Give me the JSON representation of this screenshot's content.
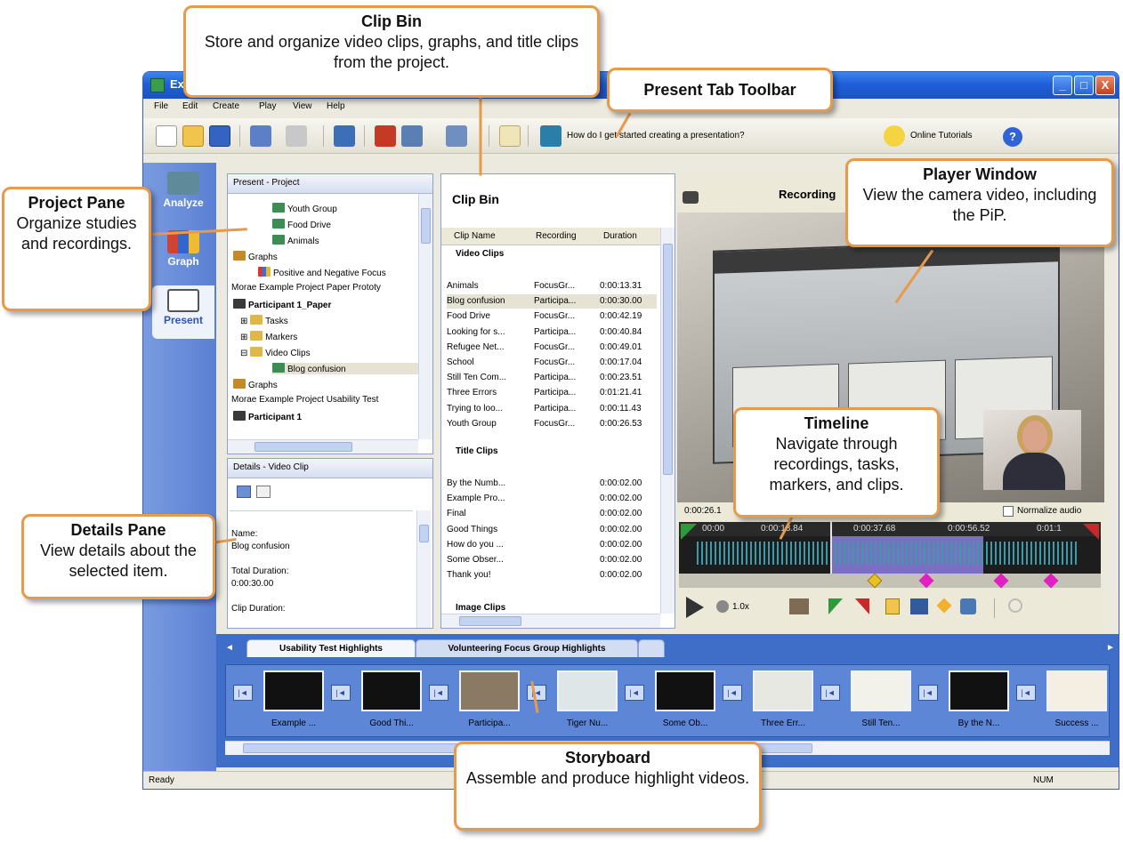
{
  "window": {
    "title": "Ex",
    "buttons": [
      "_",
      "□",
      "X"
    ]
  },
  "menu": [
    "File",
    "Edit",
    "Create",
    "Play",
    "View",
    "Help"
  ],
  "toolbar": {
    "help_text": "How do I get started creating a presentation?",
    "tutorials": "Online Tutorials",
    "help_icon": "?"
  },
  "modes": [
    {
      "label": "Analyze",
      "icon": "monitor-icon"
    },
    {
      "label": "Graph",
      "icon": "bar-graph-icon"
    },
    {
      "label": "Present",
      "icon": "presentation-icon"
    }
  ],
  "project_pane": {
    "header": "Present - Project",
    "items": [
      {
        "label": "Youth Group",
        "icon": "film-icon"
      },
      {
        "label": "Food Drive",
        "icon": "film-icon"
      },
      {
        "label": "Animals",
        "icon": "film-icon"
      },
      {
        "label": "Graphs",
        "icon": "graph-icon"
      },
      {
        "label": "Positive and Negative Focus",
        "icon": "bar-graph-icon"
      },
      {
        "label": "Morae Example Project Paper Prototy",
        "icon": ""
      },
      {
        "label": "Participant 1_Paper",
        "icon": "project-icon"
      },
      {
        "label": "Tasks",
        "icon": "folder-icon"
      },
      {
        "label": "Markers",
        "icon": "folder-icon"
      },
      {
        "label": "Video Clips",
        "icon": "folder-icon"
      },
      {
        "label": "Blog confusion",
        "icon": "film-icon"
      },
      {
        "label": "Graphs",
        "icon": "graph-icon"
      },
      {
        "label": "Morae Example Project Usability Test",
        "icon": ""
      },
      {
        "label": "Participant 1",
        "icon": "project-icon"
      }
    ]
  },
  "details_pane": {
    "header": "Details - Video Clip",
    "lines": [
      "Name:",
      "Blog confusion",
      "",
      "Total Duration:",
      "0:00:30.00",
      "",
      "Clip Duration:"
    ]
  },
  "clip_bin": {
    "title": "Clip Bin",
    "columns": [
      "Clip Name",
      "Recording",
      "Duration"
    ],
    "sections": [
      {
        "name": "Video Clips",
        "rows": [
          [
            "Animals",
            "FocusGr...",
            "0:00:13.31"
          ],
          [
            "Blog confusion",
            "Participa...",
            "0:00:30.00"
          ],
          [
            "Food Drive",
            "FocusGr...",
            "0:00:42.19"
          ],
          [
            "Looking for s...",
            "Participa...",
            "0:00:40.84"
          ],
          [
            "Refugee Net...",
            "FocusGr...",
            "0:00:49.01"
          ],
          [
            "School",
            "FocusGr...",
            "0:00:17.04"
          ],
          [
            "Still Ten Com...",
            "Participa...",
            "0:00:23.51"
          ],
          [
            "Three Errors",
            "Participa...",
            "0:01:21.41"
          ],
          [
            "Trying to loo...",
            "Participa...",
            "0:00:11.43"
          ],
          [
            "Youth Group",
            "FocusGr...",
            "0:00:26.53"
          ]
        ]
      },
      {
        "name": "Title Clips",
        "rows": [
          [
            "By the Numb...",
            "",
            "0:00:02.00"
          ],
          [
            "Example Pro...",
            "",
            "0:00:02.00"
          ],
          [
            "Final",
            "",
            "0:00:02.00"
          ],
          [
            "Good Things",
            "",
            "0:00:02.00"
          ],
          [
            "How do you ...",
            "",
            "0:00:02.00"
          ],
          [
            "Some Obser...",
            "",
            "0:00:02.00"
          ],
          [
            "Thank you!",
            "",
            "0:00:02.00"
          ]
        ]
      },
      {
        "name": "Image Clips",
        "rows": []
      }
    ]
  },
  "player": {
    "title": "Recording",
    "time": "0:00:26.1",
    "normalize": "Normalize audio",
    "timeline_ticks": [
      "00:00",
      "0:00:18.84",
      "0:00:37.68",
      "0:00:56.52",
      "0:01:1"
    ],
    "speed": "1.0x"
  },
  "storyboard": {
    "tabs": [
      "Usability Test Highlights",
      "Volunteering Focus Group Highlights"
    ],
    "clips": [
      {
        "label": "Example ...",
        "thumb": "#111111"
      },
      {
        "label": "Good Thi...",
        "thumb": "#111111"
      },
      {
        "label": "Participa...",
        "thumb": "#8a7a64"
      },
      {
        "label": "Tiger Nu...",
        "thumb": "#dfe6e8"
      },
      {
        "label": "Some Ob...",
        "thumb": "#111111"
      },
      {
        "label": "Three Err...",
        "thumb": "#e8e8e2"
      },
      {
        "label": "Still Ten...",
        "thumb": "#f2f2ea"
      },
      {
        "label": "By the N...",
        "thumb": "#111111"
      },
      {
        "label": "Success ...",
        "thumb": "#f4efe2"
      }
    ]
  },
  "status": {
    "left": "Ready",
    "right": "NUM"
  },
  "callouts": {
    "clip_bin": {
      "title": "Clip Bin",
      "body": "Store and organize video clips, graphs, and title clips from the project."
    },
    "present_toolbar": {
      "title": "Present Tab Toolbar"
    },
    "project_pane": {
      "title": "Project Pane",
      "body": "Organize studies and recordings."
    },
    "player_window": {
      "title": "Player Window",
      "body": "View the camera video, including the PiP."
    },
    "details_pane": {
      "title": "Details Pane",
      "body": "View details about the selected item."
    },
    "timeline": {
      "title": "Timeline",
      "body": "Navigate through recordings, tasks, markers, and clips."
    },
    "storyboard": {
      "title": "Storyboard",
      "body": "Assemble and produce highlight videos."
    }
  },
  "colors": {
    "callout_border": "#e79a4c",
    "titlebar": "#1f5fd8",
    "storyboard": "#3f6ec9",
    "marker_magenta": "#e020c0",
    "marker_yellow": "#e8c020"
  }
}
